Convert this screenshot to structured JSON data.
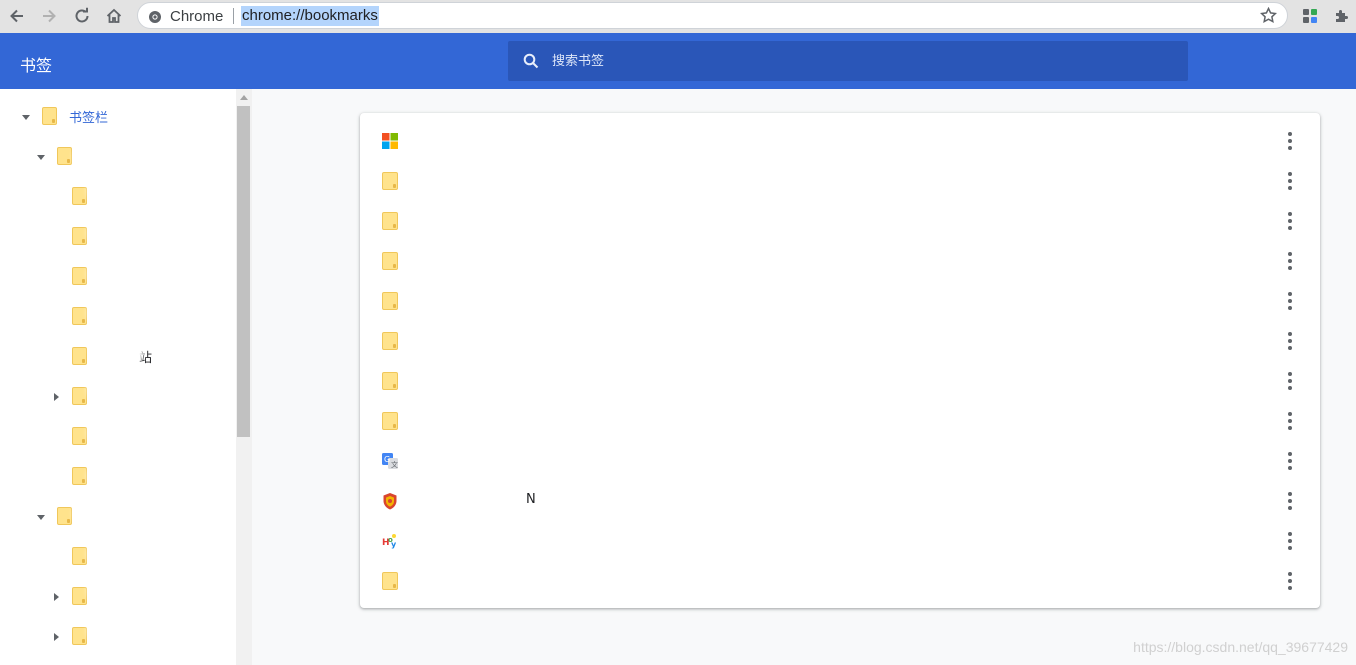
{
  "browser": {
    "site_chip": "Chrome",
    "url": "chrome://bookmarks"
  },
  "header": {
    "title": "书签",
    "search_placeholder": "搜索书签"
  },
  "sidebar": {
    "root_label": "书签栏",
    "partial_label_1": "站",
    "accent": "#3367d6",
    "folder_color": "#ffe38c"
  },
  "bookmarks": [
    {
      "title": "",
      "icon": "microsoft-logo-icon"
    },
    {
      "title": "",
      "icon": "folder-icon"
    },
    {
      "title": "",
      "icon": "folder-icon"
    },
    {
      "title": "",
      "icon": "folder-icon"
    },
    {
      "title": "",
      "icon": "folder-icon"
    },
    {
      "title": "",
      "icon": "folder-icon"
    },
    {
      "title": "",
      "icon": "folder-icon"
    },
    {
      "title": "",
      "icon": "folder-icon"
    },
    {
      "title": "",
      "icon": "google-translate-icon"
    },
    {
      "title": "N",
      "icon": "shield-favicon-icon"
    },
    {
      "title": "",
      "icon": "colorful-logo-icon"
    },
    {
      "title": "",
      "icon": "folder-icon"
    }
  ],
  "watermark": "https://blog.csdn.net/qq_39677429",
  "colors": {
    "header_bg": "#3367d6",
    "search_bg": "#2a56b8",
    "toolbar_bg": "#e3e3e3",
    "url_selection": "#b3d4fc"
  }
}
